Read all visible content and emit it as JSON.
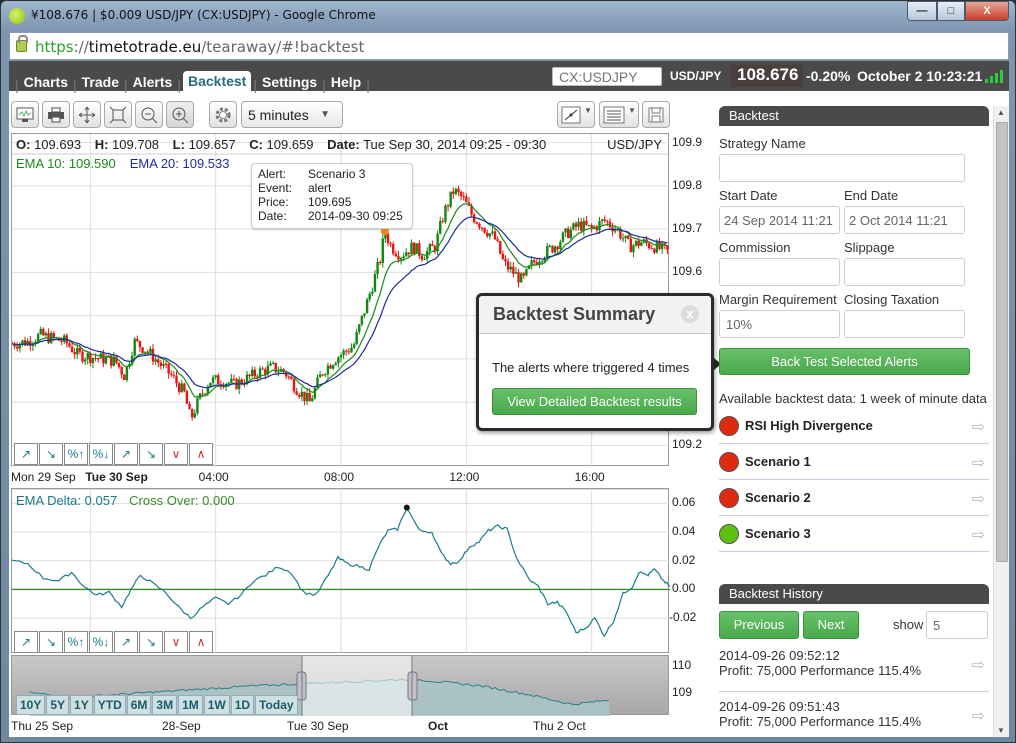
{
  "window": {
    "title": "¥108.676 | $0.009 USD/JPY (CX:USDJPY) - Google Chrome",
    "controls": {
      "minimize": "—",
      "maximize": "□",
      "close": "X"
    }
  },
  "address_bar": {
    "scheme": "https",
    "sep": "://",
    "host": "timetotrade.eu",
    "path": "/tearaway/#!backtest"
  },
  "nav": {
    "tabs": [
      {
        "label": "Charts",
        "active": false
      },
      {
        "label": "Trade",
        "active": false
      },
      {
        "label": "Alerts",
        "active": false
      },
      {
        "label": "Backtest",
        "active": true
      },
      {
        "label": "Settings",
        "active": false
      },
      {
        "label": "Help",
        "active": false
      }
    ],
    "symbol_placeholder": "CX:USDJPY",
    "symbol": "USD/JPY",
    "price": "108.676",
    "change": "-0.20%",
    "datetime": "October 2 10:23:21",
    "signal_color": "#2ecc40"
  },
  "toolbar": {
    "buttons": [
      "monitor-icon",
      "print-icon",
      "pan-icon",
      "fit-icon",
      "zoom-out-icon",
      "zoom-in-icon",
      "settings-icon"
    ],
    "interval": "5 minutes",
    "right_buttons": [
      "draw-line-icon",
      "list-icon",
      "save-icon"
    ]
  },
  "price_chart": {
    "ohlc": {
      "o_label": "O:",
      "o": "109.693",
      "h_label": "H:",
      "h": "109.708",
      "l_label": "L:",
      "l": "109.657",
      "c_label": "C:",
      "c": "109.659",
      "date_label": "Date:",
      "date": "Tue Sep 30, 2014 09:25 - 09:30"
    },
    "symbol": "USD/JPY",
    "ema10": "EMA 10: 109.590",
    "ema20": "EMA 20: 109.533",
    "tooltip": {
      "rows": [
        {
          "k": "Alert:",
          "v": "Scenario 3"
        },
        {
          "k": "Event:",
          "v": "alert"
        },
        {
          "k": "Price:",
          "v": "109.695"
        },
        {
          "k": "Date:",
          "v": "2014-09-30 09:25"
        }
      ]
    }
  },
  "chart_data": [
    {
      "type": "candlestick",
      "title": "USD/JPY 5 minutes",
      "y_ticks": [
        "109.9",
        "109.8",
        "109.7",
        "109.6",
        "109.2"
      ],
      "ylim": [
        109.15,
        109.92
      ],
      "x_ticks": [
        "Mon 29 Sep",
        "Tue 30 Sep",
        "04:00",
        "08:00",
        "12:00",
        "16:00"
      ],
      "x_range_hours": [
        -2.5,
        18.5
      ],
      "grid": true,
      "close_path": [
        [
          -2.5,
          109.435
        ],
        [
          -2.0,
          109.44
        ],
        [
          -1.6,
          109.455
        ],
        [
          -1.2,
          109.447
        ],
        [
          -0.8,
          109.44
        ],
        [
          -0.4,
          109.41
        ],
        [
          0.0,
          109.405
        ],
        [
          0.4,
          109.4
        ],
        [
          0.8,
          109.395
        ],
        [
          1.1,
          109.36
        ],
        [
          1.4,
          109.44
        ],
        [
          1.8,
          109.42
        ],
        [
          2.2,
          109.39
        ],
        [
          2.6,
          109.36
        ],
        [
          3.0,
          109.32
        ],
        [
          3.2,
          109.26
        ],
        [
          3.5,
          109.31
        ],
        [
          3.8,
          109.35
        ],
        [
          4.2,
          109.35
        ],
        [
          4.6,
          109.34
        ],
        [
          5.0,
          109.355
        ],
        [
          5.4,
          109.37
        ],
        [
          5.8,
          109.38
        ],
        [
          6.2,
          109.37
        ],
        [
          6.6,
          109.33
        ],
        [
          7.0,
          109.3
        ],
        [
          7.4,
          109.37
        ],
        [
          7.8,
          109.4
        ],
        [
          8.1,
          109.415
        ],
        [
          8.4,
          109.43
        ],
        [
          8.7,
          109.5
        ],
        [
          9.0,
          109.57
        ],
        [
          9.25,
          109.63
        ],
        [
          9.4,
          109.695
        ],
        [
          9.6,
          109.66
        ],
        [
          9.9,
          109.64
        ],
        [
          10.3,
          109.66
        ],
        [
          10.6,
          109.64
        ],
        [
          11.0,
          109.66
        ],
        [
          11.3,
          109.74
        ],
        [
          11.6,
          109.79
        ],
        [
          11.9,
          109.77
        ],
        [
          12.2,
          109.73
        ],
        [
          12.6,
          109.7
        ],
        [
          12.9,
          109.68
        ],
        [
          13.2,
          109.62
        ],
        [
          13.5,
          109.6
        ],
        [
          13.8,
          109.58
        ],
        [
          14.1,
          109.62
        ],
        [
          14.4,
          109.64
        ],
        [
          14.8,
          109.66
        ],
        [
          15.2,
          109.69
        ],
        [
          15.6,
          109.71
        ],
        [
          16.0,
          109.7
        ],
        [
          16.4,
          109.72
        ],
        [
          16.8,
          109.7
        ],
        [
          17.2,
          109.66
        ],
        [
          17.6,
          109.67
        ],
        [
          18.0,
          109.66
        ],
        [
          18.5,
          109.645
        ]
      ],
      "series": [
        {
          "name": "EMA 10",
          "color": "#1a8a1a"
        },
        {
          "name": "EMA 20",
          "color": "#1c2c9c"
        }
      ],
      "alert_marker": {
        "x_hours": 9.4,
        "price": 109.695,
        "color": "#f08a1c"
      }
    },
    {
      "type": "line",
      "title": "EMA Delta",
      "legend": [
        "EMA Delta: 0.057",
        "Cross Over: 0.000"
      ],
      "y_ticks": [
        "0.06",
        "0.04",
        "0.02",
        "0.00",
        "-0.02"
      ],
      "ylim": [
        -0.045,
        0.07
      ],
      "x_range_hours": [
        -2.5,
        18.5
      ],
      "grid": true,
      "series": [
        {
          "name": "EMA Delta",
          "color": "#1b7a8a",
          "points": [
            [
              -2.5,
              0.02
            ],
            [
              -2.0,
              0.018
            ],
            [
              -1.5,
              0.008
            ],
            [
              -1.0,
              0.006
            ],
            [
              -0.6,
              0.012
            ],
            [
              -0.2,
              0.002
            ],
            [
              0.2,
              -0.004
            ],
            [
              0.6,
              -0.002
            ],
            [
              1.0,
              -0.012
            ],
            [
              1.3,
              0.0
            ],
            [
              1.6,
              0.01
            ],
            [
              2.0,
              0.004
            ],
            [
              2.4,
              -0.002
            ],
            [
              2.8,
              -0.012
            ],
            [
              3.2,
              -0.02
            ],
            [
              3.6,
              -0.012
            ],
            [
              4.0,
              -0.006
            ],
            [
              4.4,
              -0.01
            ],
            [
              4.8,
              -0.004
            ],
            [
              5.2,
              0.006
            ],
            [
              5.6,
              0.01
            ],
            [
              6.0,
              0.016
            ],
            [
              6.4,
              0.012
            ],
            [
              6.8,
              -0.002
            ],
            [
              7.2,
              -0.004
            ],
            [
              7.6,
              0.01
            ],
            [
              7.9,
              0.022
            ],
            [
              8.2,
              0.018
            ],
            [
              8.6,
              0.016
            ],
            [
              8.9,
              0.014
            ],
            [
              9.2,
              0.03
            ],
            [
              9.5,
              0.041
            ],
            [
              9.8,
              0.042
            ],
            [
              10.1,
              0.057
            ],
            [
              10.5,
              0.041
            ],
            [
              10.9,
              0.04
            ],
            [
              11.2,
              0.025
            ],
            [
              11.5,
              0.018
            ],
            [
              11.8,
              0.02
            ],
            [
              12.1,
              0.03
            ],
            [
              12.4,
              0.033
            ],
            [
              12.7,
              0.041
            ],
            [
              13.0,
              0.044
            ],
            [
              13.3,
              0.042
            ],
            [
              13.6,
              0.022
            ],
            [
              14.0,
              0.007
            ],
            [
              14.3,
              0.002
            ],
            [
              14.6,
              -0.01
            ],
            [
              14.9,
              -0.009
            ],
            [
              15.2,
              -0.016
            ],
            [
              15.5,
              -0.03
            ],
            [
              15.8,
              -0.027
            ],
            [
              16.1,
              -0.02
            ],
            [
              16.4,
              -0.032
            ],
            [
              16.7,
              -0.022
            ],
            [
              17.0,
              -0.003
            ],
            [
              17.3,
              0.002
            ],
            [
              17.5,
              0.012
            ],
            [
              17.8,
              0.01
            ],
            [
              18.0,
              0.014
            ],
            [
              18.3,
              0.006
            ],
            [
              18.5,
              0.002
            ]
          ]
        },
        {
          "name": "Cross Over",
          "color": "#3a8a2a",
          "constant": 0.0
        }
      ],
      "peak_marker": {
        "x_hours": 10.1,
        "value": 0.057
      }
    },
    {
      "type": "area",
      "title": "Navigator",
      "y_ticks": [
        "110",
        "109"
      ],
      "x_ticks": [
        "Thu 25 Sep",
        "28-Sep",
        "Tue 30 Sep",
        "Oct",
        "Thu 2 Oct"
      ],
      "selected_range": [
        "Tue 30 Sep",
        "Oct"
      ]
    }
  ],
  "draw_tools": [
    "trend-up-icon",
    "trend-down-icon",
    "percent-up-icon",
    "percent-down-icon",
    "line-up-icon",
    "line-down-icon",
    "cross-up-icon",
    "cross-down-icon"
  ],
  "navigator": {
    "range_buttons": [
      "10Y",
      "5Y",
      "1Y",
      "YTD",
      "6M",
      "3M",
      "1M",
      "1W",
      "1D",
      "Today"
    ]
  },
  "popup": {
    "title": "Backtest Summary",
    "close": "x",
    "message": "The alerts where triggered 4 times",
    "button": "View Detailed Backtest results"
  },
  "backtest_panel": {
    "header": "Backtest",
    "strategy_name_label": "Strategy Name",
    "strategy_name_value": "",
    "start_date_label": "Start Date",
    "start_date_value": "24 Sep 2014 11:21",
    "end_date_label": "End Date",
    "end_date_value": "2 Oct 2014 11:21",
    "commission_label": "Commission",
    "commission_value": "",
    "slippage_label": "Slippage",
    "slippage_value": "",
    "margin_label": "Margin Requirement",
    "margin_value": "10%",
    "closing_label": "Closing Taxation",
    "closing_value": "",
    "run_button": "Back Test Selected Alerts",
    "available_text": "Available backtest data: 1 week of minute data",
    "alerts": [
      {
        "name": "RSI High Divergence",
        "status": "red",
        "color": "#e02a10"
      },
      {
        "name": "Scenario 1",
        "status": "red",
        "color": "#e02a10"
      },
      {
        "name": "Scenario 2",
        "status": "red",
        "color": "#e02a10"
      },
      {
        "name": "Scenario 3",
        "status": "green",
        "color": "#5cc010"
      }
    ]
  },
  "history_panel": {
    "header": "Backtest History",
    "previous": "Previous",
    "next": "Next",
    "show_label": "show",
    "show_value": "5",
    "items": [
      {
        "date": "2014-09-26 09:52:12",
        "summary": "Profit: 75,000 Performance 115.4%"
      },
      {
        "date": "2014-09-26 09:51:43",
        "summary": "Profit: 75,000 Performance 115.4%"
      }
    ]
  }
}
